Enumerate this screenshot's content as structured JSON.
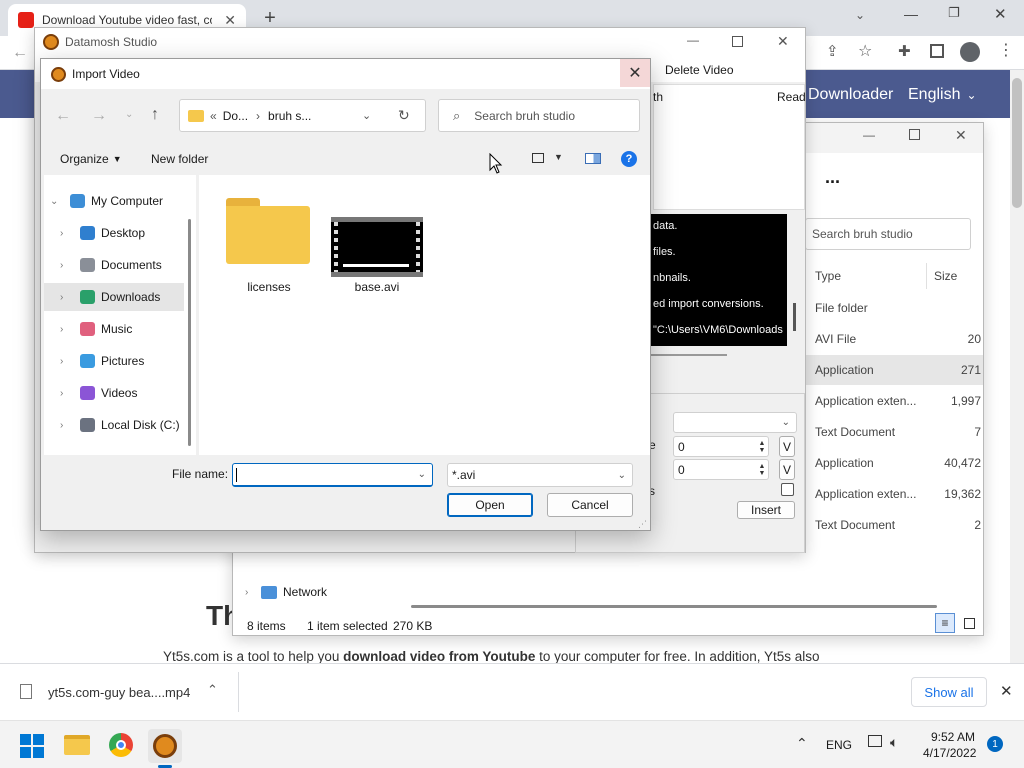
{
  "browser": {
    "tab_title": "Download Youtube video fast, co",
    "new_tab_label": "+",
    "site_nav": {
      "downloader": "Downloader",
      "language": "English"
    },
    "page_heading_partial": "Th",
    "page_text_prefix": "Yt5s.com is a tool to help you ",
    "page_text_bold": "download video from Youtube",
    "page_text_suffix": " to your computer for free. In addition, Yt5s also",
    "download_item": "yt5s.com-guy bea....mp4",
    "show_all": "Show all"
  },
  "taskbar": {
    "lang": "ENG",
    "time": "9:52 AM",
    "date": "4/17/2022",
    "notification_count": "1"
  },
  "explorer_bg": {
    "search_placeholder": "Search bruh studio",
    "more": "...",
    "columns": {
      "type": "Type",
      "size": "Size"
    },
    "rows": [
      {
        "type": "File folder",
        "size": ""
      },
      {
        "type": "AVI File",
        "size": "20"
      },
      {
        "type": "Application",
        "size": "271"
      },
      {
        "type": "Application exten...",
        "size": "1,997"
      },
      {
        "type": "Text Document",
        "size": "7"
      },
      {
        "type": "Application",
        "size": "40,472"
      },
      {
        "type": "Application exten...",
        "size": "19,362"
      },
      {
        "type": "Text Document",
        "size": "2"
      }
    ],
    "network_label": "Network",
    "local_disk_partial": "Local Disk (C:)",
    "status_items": "8 items",
    "status_selected": "1 item selected",
    "status_size": "270 KB"
  },
  "datamosh": {
    "title": "Datamosh Studio",
    "menu_delete": "Delete Video",
    "menu_read": "Read",
    "col_partial": "th",
    "console_lines": [
      "data.",
      "files.",
      "nbnails.",
      "ed import conversions.",
      "\"C:\\Users\\VM6\\Downloads"
    ],
    "field_label_e": "e",
    "field1_value": "0",
    "field2_value": "0",
    "v_button": "V",
    "insert_button": "Insert",
    "side_label_s": "s"
  },
  "dialog": {
    "title": "Import Video",
    "breadcrumb": [
      "Do...",
      "bruh s..."
    ],
    "breadcrumb_prefix": "«",
    "search_placeholder": "Search bruh studio",
    "organize": "Organize",
    "new_folder": "New folder",
    "nav": [
      {
        "label": "My Computer",
        "icon": "computer-icon",
        "expanded": true
      },
      {
        "label": "Desktop",
        "icon": "desktop-icon"
      },
      {
        "label": "Documents",
        "icon": "documents-icon"
      },
      {
        "label": "Downloads",
        "icon": "downloads-icon",
        "selected": true
      },
      {
        "label": "Music",
        "icon": "music-icon"
      },
      {
        "label": "Pictures",
        "icon": "pictures-icon"
      },
      {
        "label": "Videos",
        "icon": "videos-icon"
      },
      {
        "label": "Local Disk (C:)",
        "icon": "drive-icon"
      }
    ],
    "files": [
      {
        "name": "licenses",
        "kind": "folder"
      },
      {
        "name": "base.avi",
        "kind": "video"
      }
    ],
    "filename_label": "File name:",
    "filename_value": "",
    "filter_value": "*.avi",
    "open": "Open",
    "cancel": "Cancel"
  },
  "colors": {
    "site_header": "#4b5a8f",
    "accent": "#0067c0",
    "folder": "#f5c84c"
  }
}
